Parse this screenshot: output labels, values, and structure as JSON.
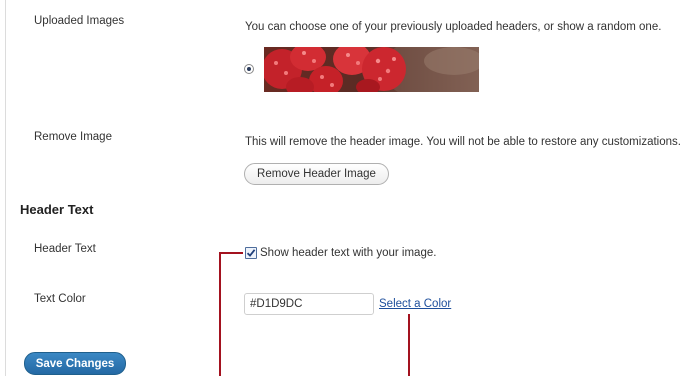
{
  "uploaded_images": {
    "label": "Uploaded Images",
    "description": "You can choose one of your previously uploaded headers, or show a random one.",
    "selected": true
  },
  "remove_image": {
    "label": "Remove Image",
    "description": "This will remove the header image. You will not be able to restore any customizations.",
    "button_label": "Remove Header Image"
  },
  "header_text_section": {
    "title": "Header Text"
  },
  "header_text": {
    "label": "Header Text",
    "checkbox_label": "Show header text with your image.",
    "checked": true
  },
  "text_color": {
    "label": "Text Color",
    "value": "#D1D9DC",
    "link_label": "Select a Color"
  },
  "save_button_label": "Save Changes",
  "colors": {
    "primary_button": "#2469a4",
    "link": "#1e4f9c",
    "callout": "#a3121f"
  }
}
